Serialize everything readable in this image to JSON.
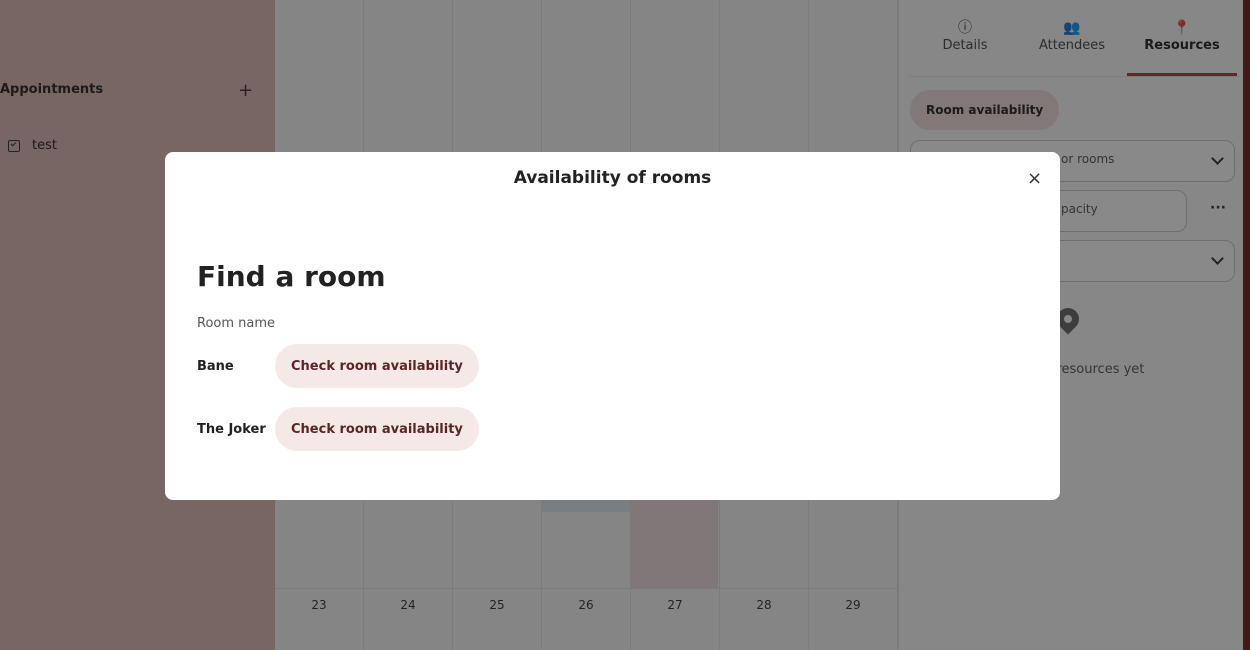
{
  "sidebar": {
    "heading": "Appointments",
    "add_label": "+",
    "items": [
      {
        "label": "test",
        "icon": "calendar-check-icon"
      }
    ]
  },
  "calendar": {
    "days": [
      "23",
      "24",
      "25",
      "26",
      "27",
      "28",
      "29"
    ]
  },
  "right_panel": {
    "tabs": [
      {
        "label": "Details",
        "icon": "info-icon",
        "glyph": "ⓘ"
      },
      {
        "label": "Attendees",
        "icon": "people-icon",
        "glyph": "👥"
      },
      {
        "label": "Resources",
        "icon": "location-pin-icon",
        "glyph": "📍"
      }
    ],
    "active_tab": "Resources",
    "room_availability_label": "Room availability",
    "filter_rooms_partial": "or rooms",
    "capacity_partial": "pacity",
    "more_label": "···",
    "empty_partial": "r resources yet"
  },
  "modal": {
    "title": "Availability of rooms",
    "close_label": "×",
    "heading": "Find a room",
    "subheading": "Room name",
    "rooms": [
      {
        "name": "Bane",
        "button": "Check room availability"
      },
      {
        "name": "The Joker",
        "button": "Check room availability"
      }
    ]
  },
  "colors": {
    "accent": "#b23b3b",
    "pill_bg": "#f0dcdc",
    "button_bg": "#f5e9e8",
    "sidebar_bg": "#dcb8b5"
  }
}
